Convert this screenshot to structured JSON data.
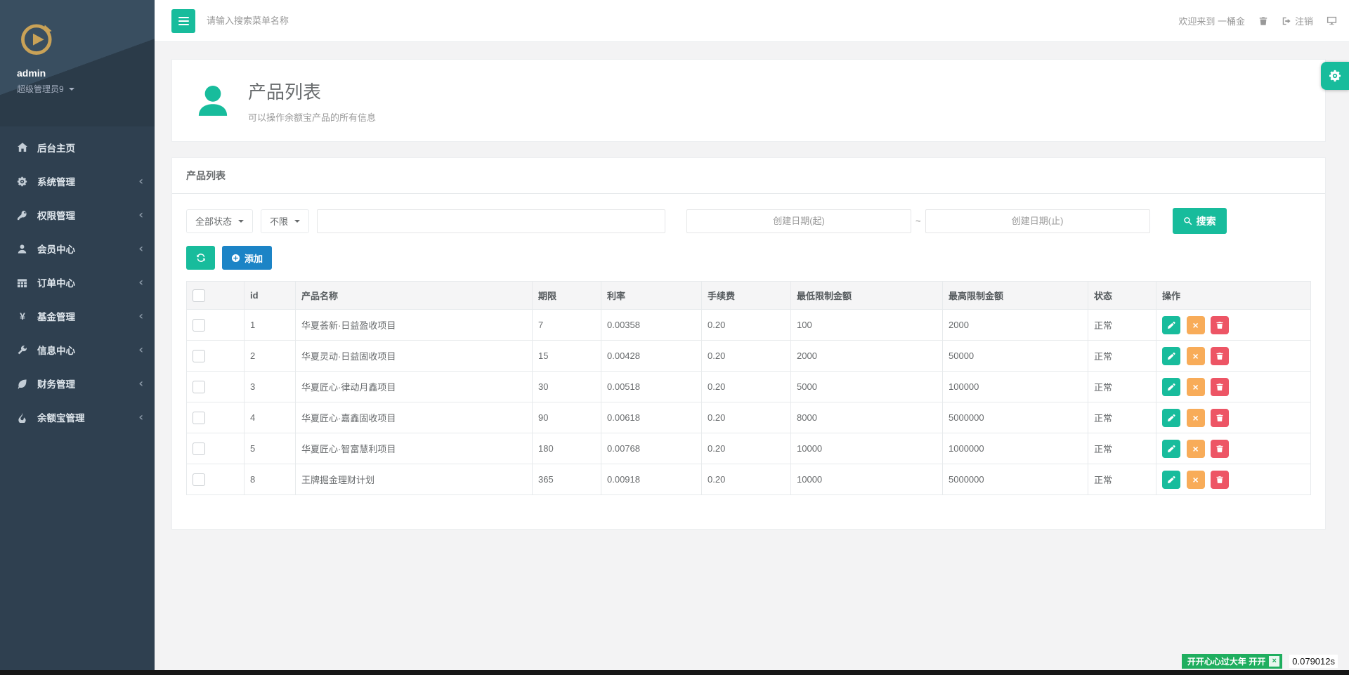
{
  "topbar": {
    "search_placeholder": "请输入搜索菜单名称",
    "welcome_text": "欢迎来到 一桶金",
    "logout_label": "注销"
  },
  "sidebar": {
    "username": "admin",
    "role": "超级管理员9",
    "items": [
      {
        "label": "后台主页",
        "icon": "home-icon",
        "has_children": false
      },
      {
        "label": "系统管理",
        "icon": "gears-icon",
        "has_children": true
      },
      {
        "label": "权限管理",
        "icon": "key-icon",
        "has_children": true
      },
      {
        "label": "会员中心",
        "icon": "user-icon",
        "has_children": true
      },
      {
        "label": "订单中心",
        "icon": "table-icon",
        "has_children": true
      },
      {
        "label": "基金管理",
        "icon": "yen-icon",
        "has_children": true
      },
      {
        "label": "信息中心",
        "icon": "wrench-icon",
        "has_children": true
      },
      {
        "label": "财务管理",
        "icon": "leaf-icon",
        "has_children": true
      },
      {
        "label": "余额宝管理",
        "icon": "fire-icon",
        "has_children": true
      }
    ]
  },
  "page_header": {
    "title": "产品列表",
    "subtitle": "可以操作余额宝产品的所有信息"
  },
  "panel": {
    "title": "产品列表",
    "filters": {
      "status_dropdown": "全部状态",
      "range_dropdown": "不限",
      "keyword_value": "",
      "date_start_placeholder": "创建日期(起)",
      "date_separator": "~",
      "date_end_placeholder": "创建日期(止)",
      "search_button": "搜索",
      "add_button": "添加"
    },
    "table": {
      "headers": [
        "id",
        "产品名称",
        "期限",
        "利率",
        "手续费",
        "最低限制金额",
        "最高限制金额",
        "状态",
        "操作"
      ],
      "rows": [
        {
          "id": "1",
          "name": "华夏荟新·日益盈收项目",
          "term": "7",
          "rate": "0.00358",
          "fee": "0.20",
          "min": "100",
          "max": "2000",
          "status": "正常"
        },
        {
          "id": "2",
          "name": "华夏灵动·日益固收项目",
          "term": "15",
          "rate": "0.00428",
          "fee": "0.20",
          "min": "2000",
          "max": "50000",
          "status": "正常"
        },
        {
          "id": "3",
          "name": "华夏匠心·律动月鑫项目",
          "term": "30",
          "rate": "0.00518",
          "fee": "0.20",
          "min": "5000",
          "max": "100000",
          "status": "正常"
        },
        {
          "id": "4",
          "name": "华夏匠心·嘉鑫固收项目",
          "term": "90",
          "rate": "0.00618",
          "fee": "0.20",
          "min": "8000",
          "max": "5000000",
          "status": "正常"
        },
        {
          "id": "5",
          "name": "华夏匠心·智富慧利项目",
          "term": "180",
          "rate": "0.00768",
          "fee": "0.20",
          "min": "10000",
          "max": "1000000",
          "status": "正常"
        },
        {
          "id": "8",
          "name": "王牌掘金理财计划",
          "term": "365",
          "rate": "0.00918",
          "fee": "0.20",
          "min": "10000",
          "max": "5000000",
          "status": "正常"
        }
      ]
    }
  },
  "footer": {
    "badge_text": "开开心心过大年 开开",
    "timer": "0.079012s"
  },
  "colors": {
    "accent_green": "#18bc9c",
    "accent_blue": "#1c84c6",
    "warn_orange": "#f8ac59",
    "danger_red": "#ed5565",
    "promo_green": "#1fae5f",
    "sidebar_bg": "#2f4050",
    "gold": "#c9a257"
  }
}
